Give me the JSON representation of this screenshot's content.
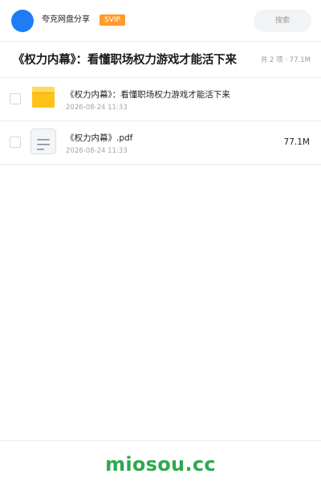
{
  "header": {
    "brand_name": "夸克网盘分享",
    "svip_label": "SVIP",
    "search_placeholder": "搜索"
  },
  "title_bar": {
    "title": "《权力内幕》：看懂职场权力游戏才能活下来",
    "summary": "共 2 项 · 77.1M"
  },
  "files": [
    {
      "type": "folder",
      "icon": "folder-icon",
      "name": "《权力内幕》：看懂职场权力游戏才能活下来",
      "date": "2026-08-24 11:33",
      "size": ""
    },
    {
      "type": "pdf",
      "icon": "document-icon",
      "name": "《权力内幕》.pdf",
      "date": "2026-08-24 11:33",
      "size": "77.1M"
    }
  ],
  "footer": {
    "logo_text": "miosou.cc"
  },
  "colors": {
    "accent_blue": "#1f7cf6",
    "svip_orange": "#ff9a2e",
    "folder_yellow": "#ffc21a",
    "logo_green": "#2fa84f"
  }
}
